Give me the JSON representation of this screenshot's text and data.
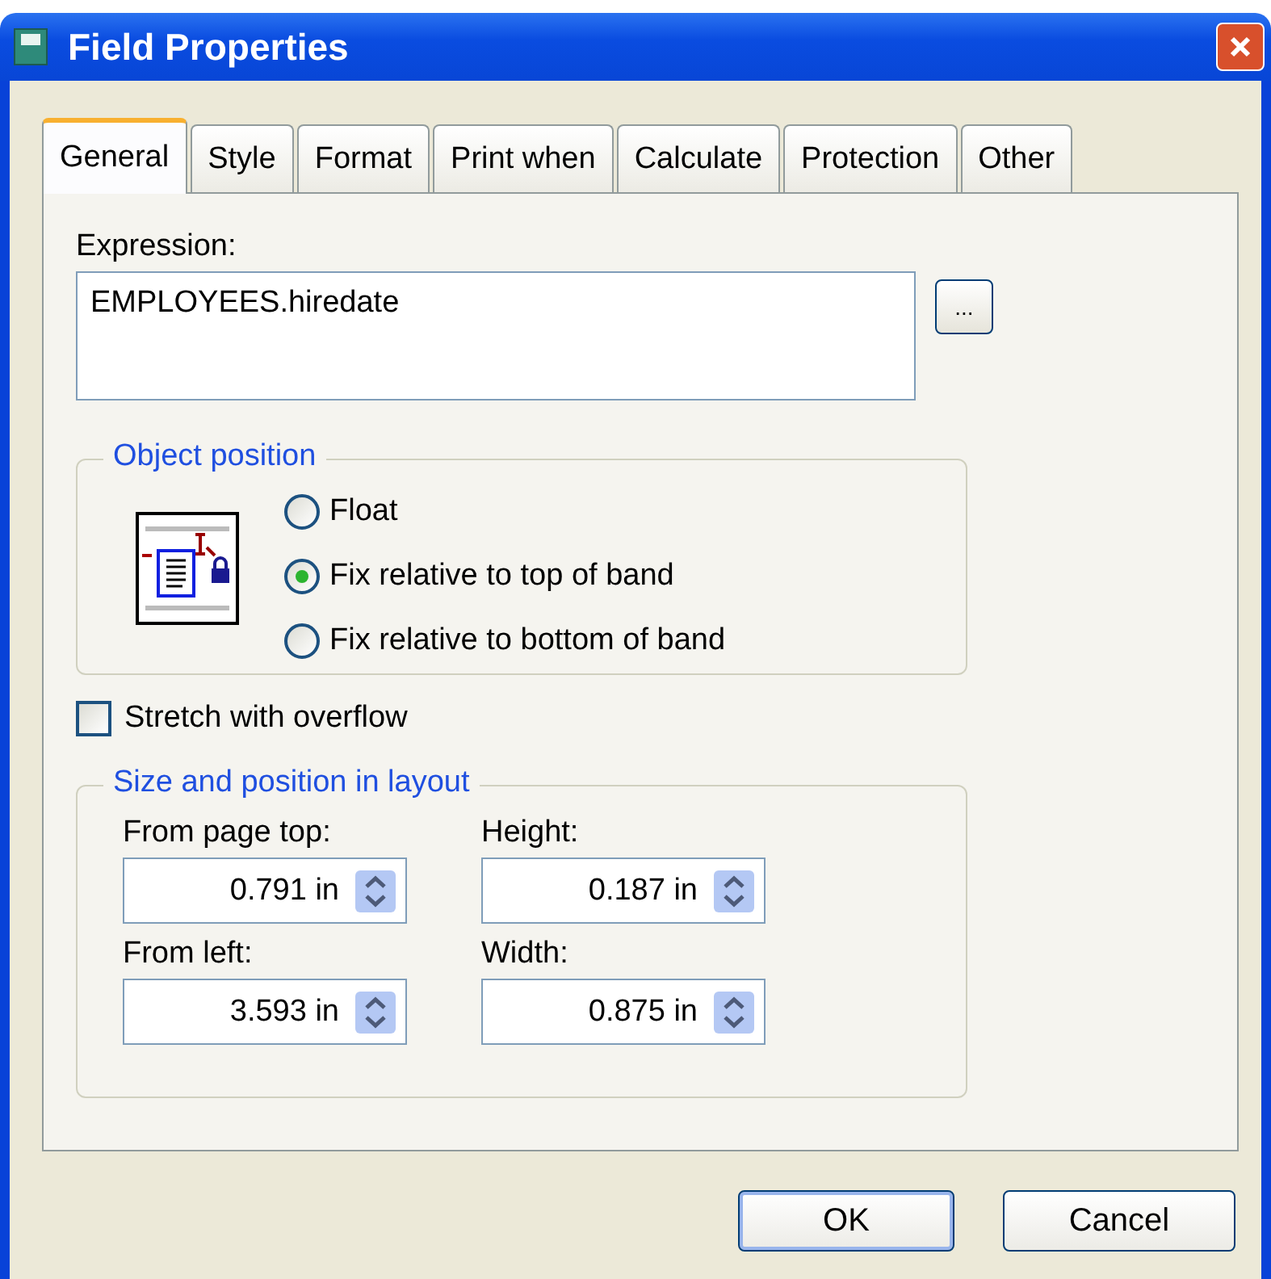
{
  "window": {
    "title": "Field Properties"
  },
  "tabs": [
    {
      "label": "General",
      "selected": true
    },
    {
      "label": "Style",
      "selected": false
    },
    {
      "label": "Format",
      "selected": false
    },
    {
      "label": "Print when",
      "selected": false
    },
    {
      "label": "Calculate",
      "selected": false
    },
    {
      "label": "Protection",
      "selected": false
    },
    {
      "label": "Other",
      "selected": false
    }
  ],
  "expression": {
    "label": "Expression:",
    "value": "EMPLOYEES.hiredate",
    "browse_button": "..."
  },
  "object_position": {
    "title": "Object position",
    "options": [
      {
        "label": "Float",
        "selected": false
      },
      {
        "label": "Fix relative to top of band",
        "selected": true
      },
      {
        "label": "Fix relative to bottom of band",
        "selected": false
      }
    ]
  },
  "stretch": {
    "label": "Stretch with overflow",
    "checked": false
  },
  "size_position": {
    "title": "Size and position in layout",
    "fields": [
      {
        "label": "From page top:",
        "value": "0.791 in"
      },
      {
        "label": "Height:",
        "value": "0.187 in"
      },
      {
        "label": "From left:",
        "value": "3.593 in"
      },
      {
        "label": "Width:",
        "value": "0.875 in"
      }
    ]
  },
  "buttons": [
    "OK",
    "Cancel"
  ]
}
